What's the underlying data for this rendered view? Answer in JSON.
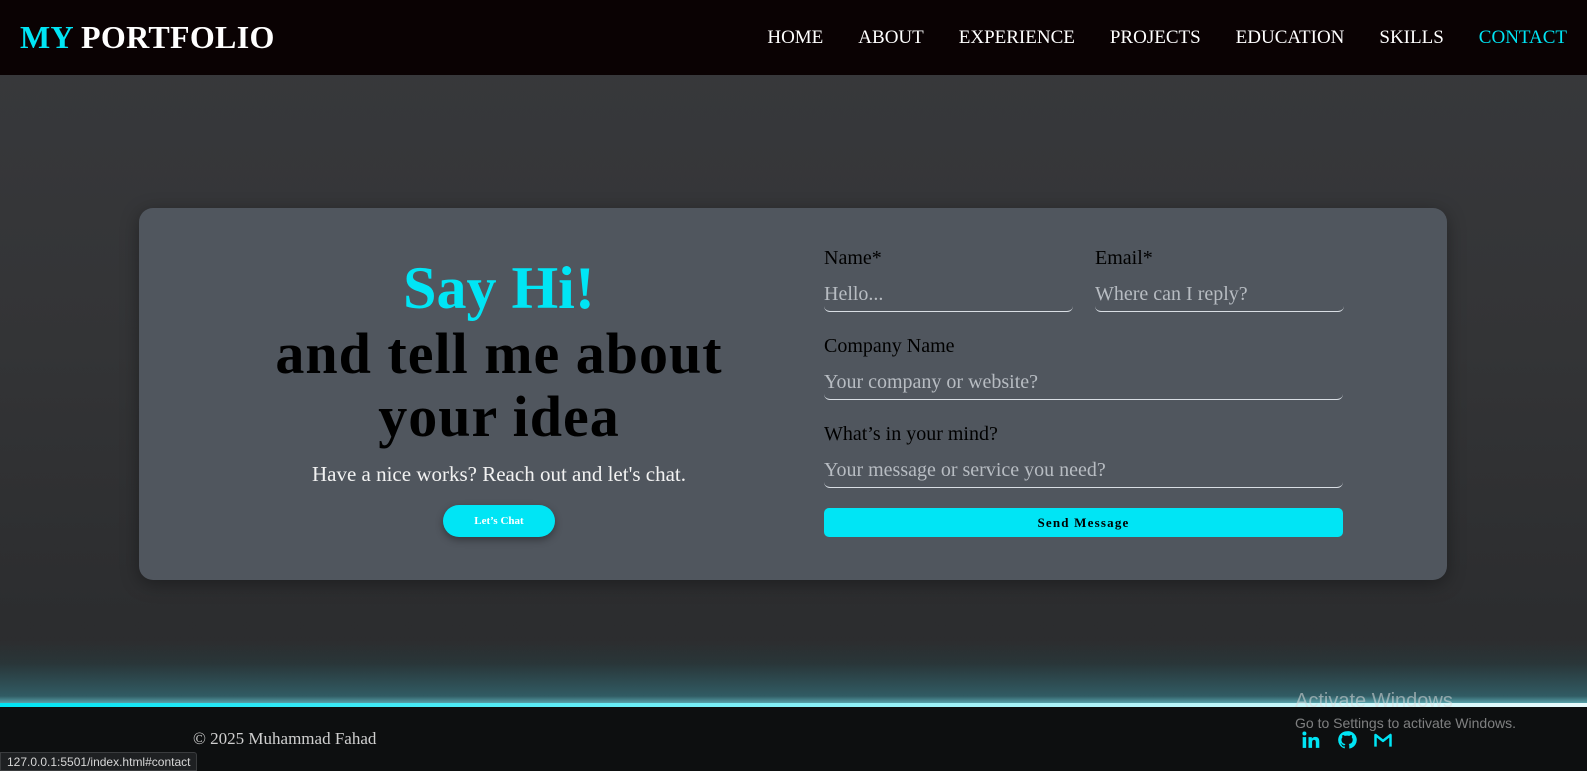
{
  "navbar": {
    "logo_accent": "MY",
    "logo_rest": "PORTFOLIO",
    "links": [
      "HOME",
      "ABOUT",
      "EXPERIENCE",
      "PROJECTS",
      "EDUCATION",
      "SKILLS",
      "CONTACT"
    ],
    "active": "CONTACT"
  },
  "hero": {
    "hi": "Say Hi!",
    "title_line1": "and tell me about",
    "title_line2": "your idea",
    "subtitle": "Have a nice works? Reach out and let's chat.",
    "chat_button": "Let’s Chat"
  },
  "form": {
    "name": {
      "label": "Name*",
      "placeholder": "Hello..."
    },
    "email": {
      "label": "Email*",
      "placeholder": "Where can I reply?"
    },
    "company": {
      "label": "Company Name",
      "placeholder": "Your company or website?"
    },
    "message": {
      "label": "What’s in your mind?",
      "placeholder": "Your message or service you need?"
    },
    "send_button": "Send Message"
  },
  "footer": {
    "copyright": "© 2025 Muhammad Fahad",
    "socials": [
      "linkedin-icon",
      "github-icon",
      "gmail-icon"
    ]
  },
  "watermark": {
    "line1": "Activate Windows",
    "line2": "Go to Settings to activate Windows."
  },
  "status_bar": {
    "url": "127.0.0.1:5501/index.html#contact"
  },
  "colors": {
    "accent": "#00e5f5",
    "nav_bg": "#0a0203",
    "card_bg": "#50565e",
    "footer_bg": "#0d0f10"
  }
}
